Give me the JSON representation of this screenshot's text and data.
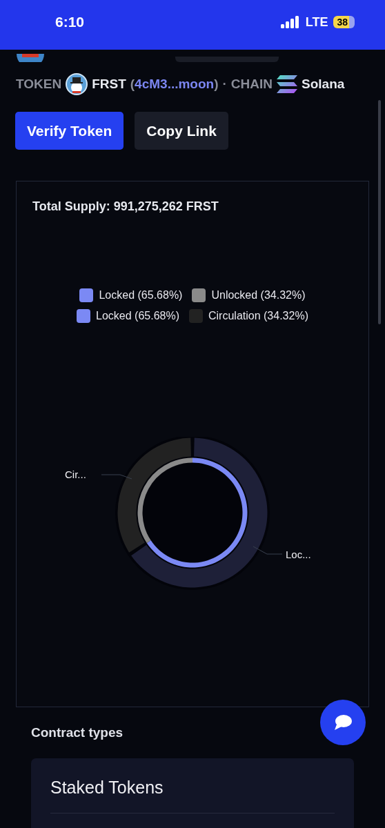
{
  "status_bar": {
    "time": "6:10",
    "network": "LTE",
    "battery": "38"
  },
  "token_row": {
    "token_label": "TOKEN",
    "symbol": "FRST",
    "address_open": "(",
    "address": "4cM3...moon",
    "address_close": ")",
    "separator": "·",
    "chain_label": "CHAIN",
    "chain": "Solana"
  },
  "buttons": [
    {
      "label": "Verify Token",
      "kind": "primary"
    },
    {
      "label": "Copy Link",
      "kind": "secondary"
    }
  ],
  "supply_card": {
    "title": "Total Supply: 991,275,262 FRST",
    "legend": [
      [
        {
          "label": "Locked (65.68%)",
          "color": "#7b89f4"
        },
        {
          "label": "Unlocked (34.32%)",
          "color": "#8a8a8a"
        }
      ],
      [
        {
          "label": "Locked (65.68%)",
          "color": "#7b89f4"
        },
        {
          "label": "Circulation (34.32%)",
          "color": "#222222"
        }
      ]
    ],
    "chart_data": {
      "type": "donut",
      "categories": [
        "Loc...",
        "Cir..."
      ],
      "series": [
        {
          "colors": [
            "#1e2038",
            "#222222"
          ],
          "values": [
            65.68,
            34.32
          ]
        },
        {
          "colors": [
            "#7b89f4",
            "#8a8a8a"
          ],
          "values": [
            65.68,
            34.32
          ]
        }
      ]
    }
  },
  "contract_types": {
    "title": "Contract types",
    "items": [
      {
        "label": "Staked Tokens"
      }
    ]
  }
}
